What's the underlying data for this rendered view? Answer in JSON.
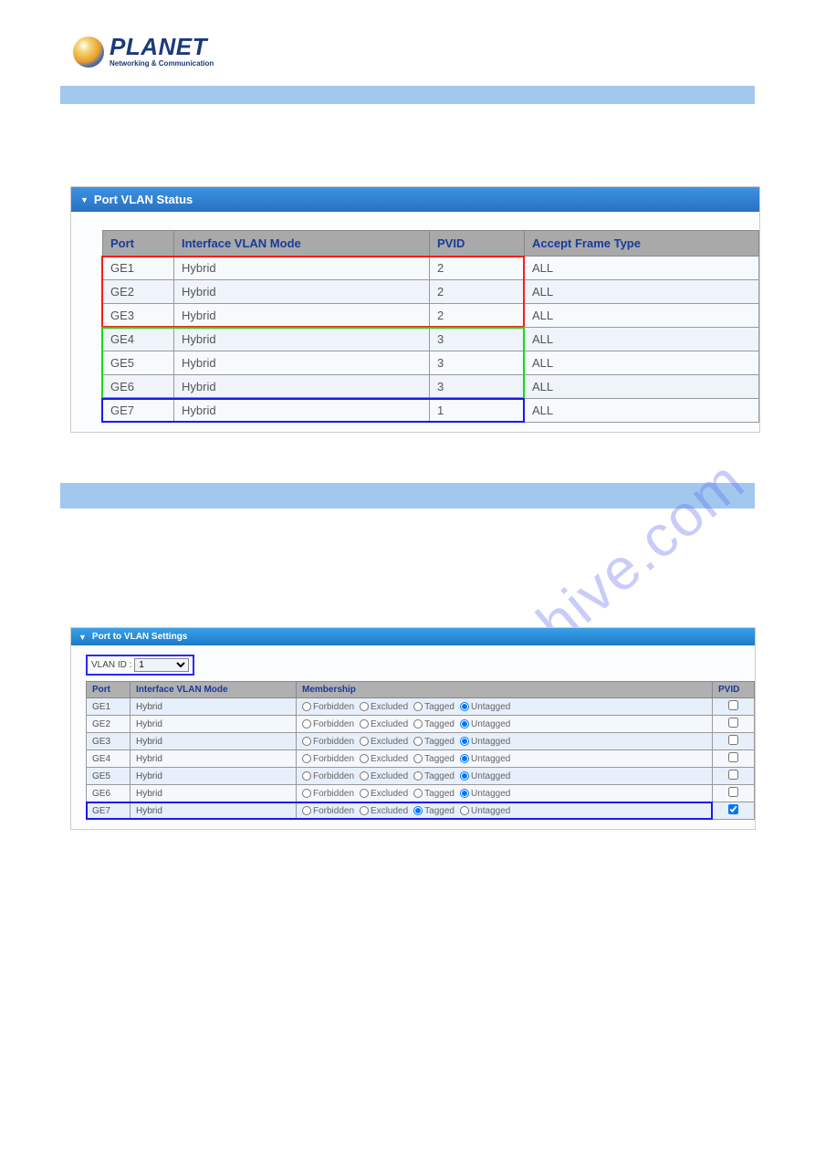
{
  "logo": {
    "main": "PLANET",
    "sub": "Networking & Communication"
  },
  "watermark": "manualshive.com",
  "panel1": {
    "title": "Port VLAN Status",
    "headers": {
      "port": "Port",
      "mode": "Interface VLAN Mode",
      "pvid": "PVID",
      "aft": "Accept Frame Type"
    },
    "rows": [
      {
        "port": "GE1",
        "mode": "Hybrid",
        "pvid": "2",
        "aft": "ALL"
      },
      {
        "port": "GE2",
        "mode": "Hybrid",
        "pvid": "2",
        "aft": "ALL"
      },
      {
        "port": "GE3",
        "mode": "Hybrid",
        "pvid": "2",
        "aft": "ALL"
      },
      {
        "port": "GE4",
        "mode": "Hybrid",
        "pvid": "3",
        "aft": "ALL"
      },
      {
        "port": "GE5",
        "mode": "Hybrid",
        "pvid": "3",
        "aft": "ALL"
      },
      {
        "port": "GE6",
        "mode": "Hybrid",
        "pvid": "3",
        "aft": "ALL"
      },
      {
        "port": "GE7",
        "mode": "Hybrid",
        "pvid": "1",
        "aft": "ALL"
      }
    ],
    "highlights": [
      {
        "color": "#ff1a1a",
        "rows_from": 0,
        "rows_to": 2
      },
      {
        "color": "#18d818",
        "rows_from": 3,
        "rows_to": 5
      },
      {
        "color": "#1a1af0",
        "rows_from": 6,
        "rows_to": 6
      }
    ]
  },
  "panel2": {
    "title": "Port to VLAN Settings",
    "vlan_id_label": "VLAN ID :",
    "vlan_id_value": "1",
    "headers": {
      "port": "Port",
      "mode": "Interface VLAN Mode",
      "memb": "Membership",
      "pvid": "PVID"
    },
    "membership_options": [
      "Forbidden",
      "Excluded",
      "Tagged",
      "Untagged"
    ],
    "rows": [
      {
        "port": "GE1",
        "mode": "Hybrid",
        "selected": "Untagged",
        "pvid": false
      },
      {
        "port": "GE2",
        "mode": "Hybrid",
        "selected": "Untagged",
        "pvid": false
      },
      {
        "port": "GE3",
        "mode": "Hybrid",
        "selected": "Untagged",
        "pvid": false
      },
      {
        "port": "GE4",
        "mode": "Hybrid",
        "selected": "Untagged",
        "pvid": false
      },
      {
        "port": "GE5",
        "mode": "Hybrid",
        "selected": "Untagged",
        "pvid": false
      },
      {
        "port": "GE6",
        "mode": "Hybrid",
        "selected": "Untagged",
        "pvid": false
      },
      {
        "port": "GE7",
        "mode": "Hybrid",
        "selected": "Tagged",
        "pvid": true
      }
    ],
    "highlight_row": 6
  }
}
